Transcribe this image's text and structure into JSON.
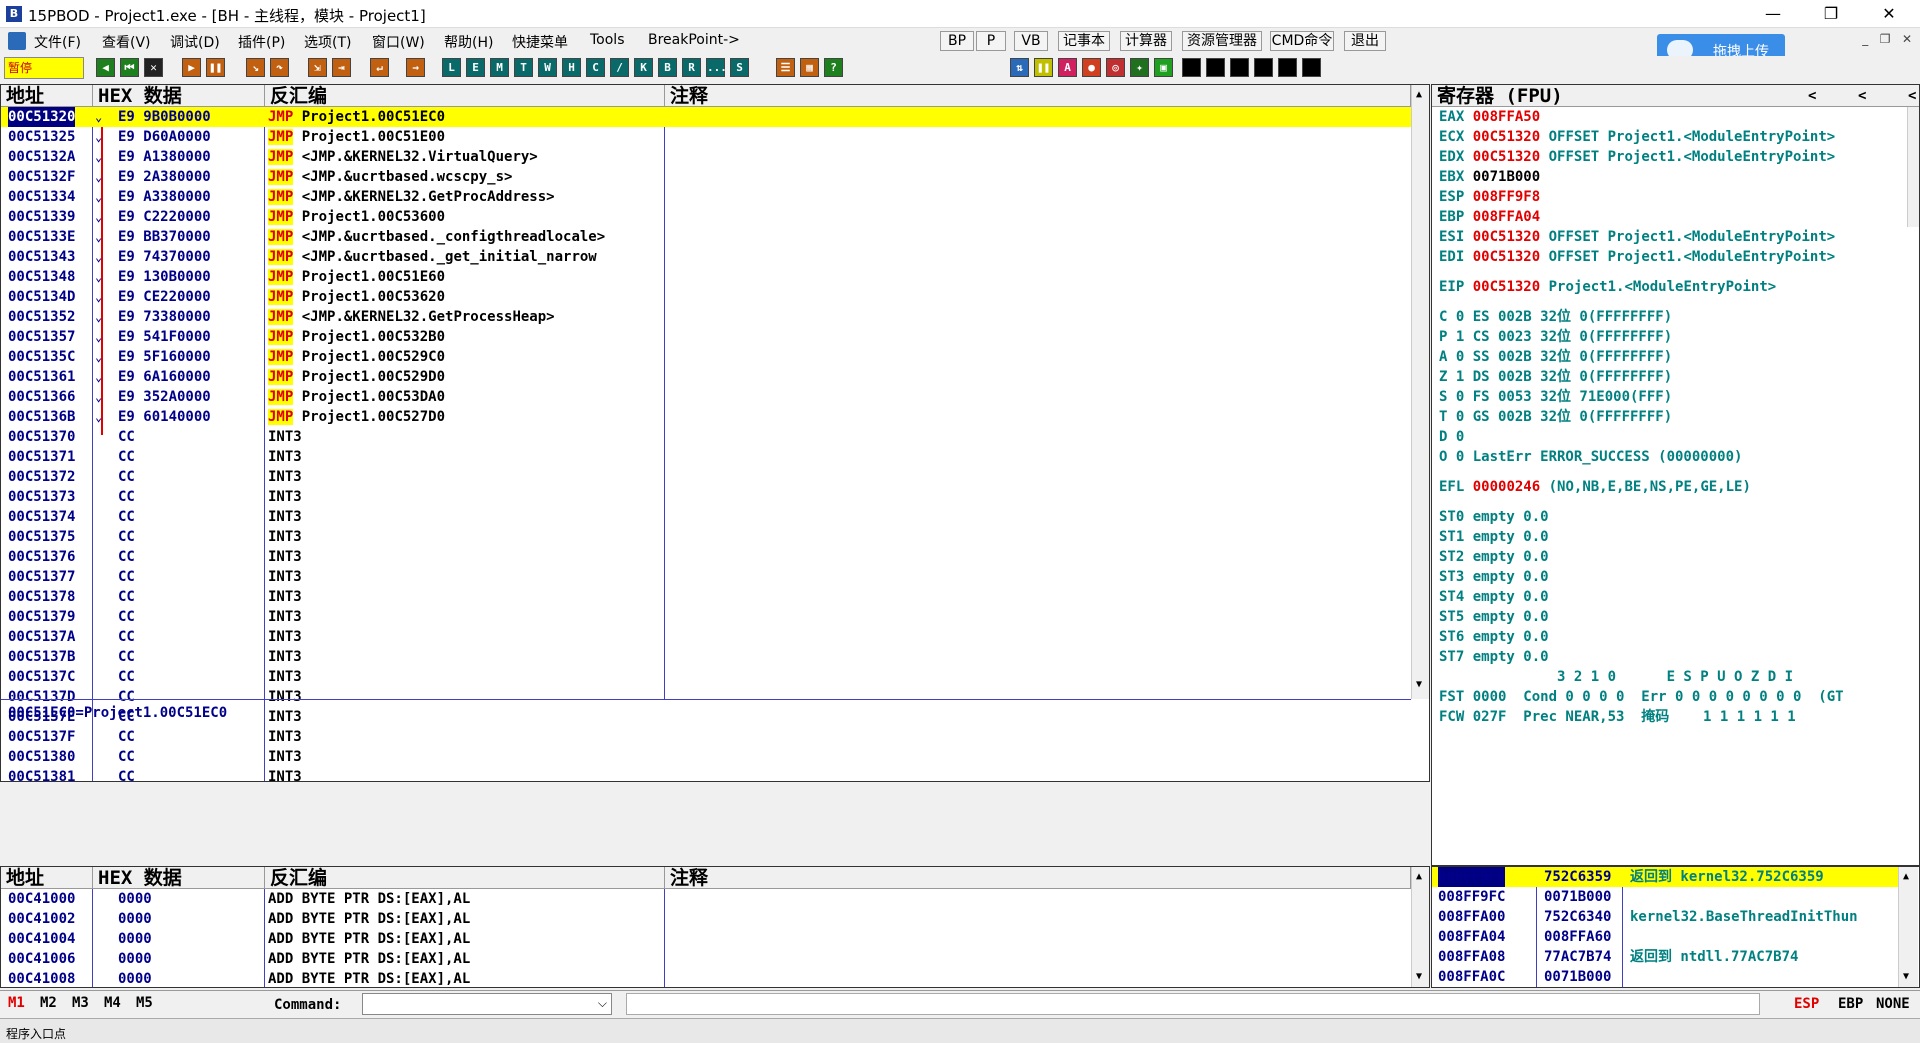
{
  "window": {
    "title": "15PBOD - Project1.exe - [BH - 主线程，模块 - Project1]",
    "minimize": "—",
    "maximize": "❐",
    "close": "✕"
  },
  "menu": [
    "文件(F)",
    "查看(V)",
    "调试(D)",
    "插件(P)",
    "选项(T)",
    "窗口(W)",
    "帮助(H)",
    "快捷菜单",
    "Tools",
    "BreakPoint->"
  ],
  "menu_buttons": [
    "BP",
    "P",
    "VB",
    "记事本",
    "计算器",
    "资源管理器",
    "CMD命令",
    "退出"
  ],
  "upload_button": "拖拽上传",
  "status_paused": "暂停",
  "toolbar_letters": [
    "L",
    "E",
    "M",
    "T",
    "W",
    "H",
    "C",
    "/",
    "K",
    "B",
    "R",
    "...",
    "S"
  ],
  "cpu": {
    "headers": [
      "地址",
      "HEX 数据",
      "反汇编",
      "注释"
    ],
    "rows": [
      {
        "addr": "00C51320",
        "hex": "E9 9B0B0000",
        "op": "JMP",
        "arg": "Project1.00C51EC0",
        "sel": true
      },
      {
        "addr": "00C51325",
        "hex": "E9 D60A0000",
        "op": "JMP",
        "arg": "Project1.00C51E00"
      },
      {
        "addr": "00C5132A",
        "hex": "E9 A1380000",
        "op": "JMP",
        "arg": "<JMP.&KERNEL32.VirtualQuery>"
      },
      {
        "addr": "00C5132F",
        "hex": "E9 2A380000",
        "op": "JMP",
        "arg": "<JMP.&ucrtbased.wcscpy_s>"
      },
      {
        "addr": "00C51334",
        "hex": "E9 A3380000",
        "op": "JMP",
        "arg": "<JMP.&KERNEL32.GetProcAddress>"
      },
      {
        "addr": "00C51339",
        "hex": "E9 C2220000",
        "op": "JMP",
        "arg": "Project1.00C53600"
      },
      {
        "addr": "00C5133E",
        "hex": "E9 BB370000",
        "op": "JMP",
        "arg": "<JMP.&ucrtbased._configthreadlocale>"
      },
      {
        "addr": "00C51343",
        "hex": "E9 74370000",
        "op": "JMP",
        "arg": "<JMP.&ucrtbased._get_initial_narrow"
      },
      {
        "addr": "00C51348",
        "hex": "E9 130B0000",
        "op": "JMP",
        "arg": "Project1.00C51E60"
      },
      {
        "addr": "00C5134D",
        "hex": "E9 CE220000",
        "op": "JMP",
        "arg": "Project1.00C53620"
      },
      {
        "addr": "00C51352",
        "hex": "E9 73380000",
        "op": "JMP",
        "arg": "<JMP.&KERNEL32.GetProcessHeap>"
      },
      {
        "addr": "00C51357",
        "hex": "E9 541F0000",
        "op": "JMP",
        "arg": "Project1.00C532B0"
      },
      {
        "addr": "00C5135C",
        "hex": "E9 5F160000",
        "op": "JMP",
        "arg": "Project1.00C529C0"
      },
      {
        "addr": "00C51361",
        "hex": "E9 6A160000",
        "op": "JMP",
        "arg": "Project1.00C529D0"
      },
      {
        "addr": "00C51366",
        "hex": "E9 352A0000",
        "op": "JMP",
        "arg": "Project1.00C53DA0"
      },
      {
        "addr": "00C5136B",
        "hex": "E9 60140000",
        "op": "JMP",
        "arg": "Project1.00C527D0"
      },
      {
        "addr": "00C51370",
        "hex": "CC",
        "op": "",
        "arg": "INT3"
      },
      {
        "addr": "00C51371",
        "hex": "CC",
        "op": "",
        "arg": "INT3"
      },
      {
        "addr": "00C51372",
        "hex": "CC",
        "op": "",
        "arg": "INT3"
      },
      {
        "addr": "00C51373",
        "hex": "CC",
        "op": "",
        "arg": "INT3"
      },
      {
        "addr": "00C51374",
        "hex": "CC",
        "op": "",
        "arg": "INT3"
      },
      {
        "addr": "00C51375",
        "hex": "CC",
        "op": "",
        "arg": "INT3"
      },
      {
        "addr": "00C51376",
        "hex": "CC",
        "op": "",
        "arg": "INT3"
      },
      {
        "addr": "00C51377",
        "hex": "CC",
        "op": "",
        "arg": "INT3"
      },
      {
        "addr": "00C51378",
        "hex": "CC",
        "op": "",
        "arg": "INT3"
      },
      {
        "addr": "00C51379",
        "hex": "CC",
        "op": "",
        "arg": "INT3"
      },
      {
        "addr": "00C5137A",
        "hex": "CC",
        "op": "",
        "arg": "INT3"
      },
      {
        "addr": "00C5137B",
        "hex": "CC",
        "op": "",
        "arg": "INT3"
      },
      {
        "addr": "00C5137C",
        "hex": "CC",
        "op": "",
        "arg": "INT3"
      },
      {
        "addr": "00C5137D",
        "hex": "CC",
        "op": "",
        "arg": "INT3"
      },
      {
        "addr": "00C5137E",
        "hex": "CC",
        "op": "",
        "arg": "INT3"
      },
      {
        "addr": "00C5137F",
        "hex": "CC",
        "op": "",
        "arg": "INT3"
      },
      {
        "addr": "00C51380",
        "hex": "CC",
        "op": "",
        "arg": "INT3"
      },
      {
        "addr": "00C51381",
        "hex": "CC",
        "op": "",
        "arg": "INT3"
      }
    ],
    "info": "00C51EC0=Project1.00C51EC0"
  },
  "registers": {
    "header": "寄存器 (FPU)",
    "lines": [
      {
        "name": "EAX",
        "val": "008FFA50",
        "note": ""
      },
      {
        "name": "ECX",
        "val": "00C51320",
        "note": "OFFSET Project1.<ModuleEntryPoint>"
      },
      {
        "name": "EDX",
        "val": "00C51320",
        "note": "OFFSET Project1.<ModuleEntryPoint>"
      },
      {
        "name": "EBX",
        "val": "0071B000",
        "note": ""
      },
      {
        "name": "ESP",
        "val": "008FF9F8",
        "note": ""
      },
      {
        "name": "EBP",
        "val": "008FFA04",
        "note": ""
      },
      {
        "name": "ESI",
        "val": "00C51320",
        "note": "OFFSET Project1.<ModuleEntryPoint>"
      },
      {
        "name": "EDI",
        "val": "00C51320",
        "note": "OFFSET Project1.<ModuleEntryPoint>"
      }
    ],
    "eip": {
      "name": "EIP",
      "val": "00C51320",
      "note": "Project1.<ModuleEntryPoint>"
    },
    "flags": [
      "C 0  ES 002B 32位 0(FFFFFFFF)",
      "P 1  CS 0023 32位 0(FFFFFFFF)",
      "A 0  SS 002B 32位 0(FFFFFFFF)",
      "Z 1  DS 002B 32位 0(FFFFFFFF)",
      "S 0  FS 0053 32位 71E000(FFF)",
      "T 0  GS 002B 32位 0(FFFFFFFF)",
      "D 0",
      "O 0  LastErr ERROR_SUCCESS (00000000)"
    ],
    "efl": {
      "name": "EFL",
      "val": "00000246",
      "note": "(NO,NB,E,BE,NS,PE,GE,LE)"
    },
    "fpu": [
      "ST0 empty 0.0",
      "ST1 empty 0.0",
      "ST2 empty 0.0",
      "ST3 empty 0.0",
      "ST4 empty 0.0",
      "ST5 empty 0.0",
      "ST6 empty 0.0",
      "ST7 empty 0.0"
    ],
    "fpu_bits": "              3 2 1 0      E S P U O Z D I",
    "fst": "FST 0000  Cond 0 0 0 0  Err 0 0 0 0 0 0 0 0  (GT",
    "fcw": "FCW 027F  Prec NEAR,53  掩码    1 1 1 1 1 1"
  },
  "dump": {
    "headers": [
      "地址",
      "HEX 数据",
      "反汇编",
      "注释"
    ],
    "rows": [
      {
        "addr": "00C41000",
        "hex": "0000",
        "arg": "ADD BYTE PTR DS:[EAX],AL"
      },
      {
        "addr": "00C41002",
        "hex": "0000",
        "arg": "ADD BYTE PTR DS:[EAX],AL"
      },
      {
        "addr": "00C41004",
        "hex": "0000",
        "arg": "ADD BYTE PTR DS:[EAX],AL"
      },
      {
        "addr": "00C41006",
        "hex": "0000",
        "arg": "ADD BYTE PTR DS:[EAX],AL"
      },
      {
        "addr": "00C41008",
        "hex": "0000",
        "arg": "ADD BYTE PTR DS:[EAX],AL"
      }
    ]
  },
  "stack": {
    "rows": [
      {
        "addr": "008FF9F8",
        "val": "752C6359",
        "note": "返回到 kernel32.752C6359",
        "sel": true
      },
      {
        "addr": "008FF9FC",
        "val": "0071B000",
        "note": ""
      },
      {
        "addr": "008FFA00",
        "val": "752C6340",
        "note": "kernel32.BaseThreadInitThun"
      },
      {
        "addr": "008FFA04",
        "val": "008FFA60",
        "note": ""
      },
      {
        "addr": "008FFA08",
        "val": "77AC7B74",
        "note": "返回到 ntdll.77AC7B74"
      },
      {
        "addr": "008FFA0C",
        "val": "0071B000",
        "note": ""
      }
    ]
  },
  "bottom": {
    "m_tabs": [
      "M1",
      "M2",
      "M3",
      "M4",
      "M5"
    ],
    "command_label": "Command:",
    "right": [
      "ESP",
      "EBP",
      "NONE"
    ],
    "status_text": "程序入口点"
  }
}
